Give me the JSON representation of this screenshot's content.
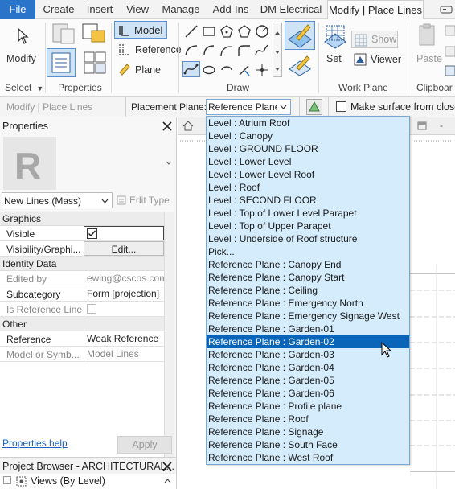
{
  "ribbon": {
    "tabs": [
      "File",
      "Create",
      "Insert",
      "View",
      "Manage",
      "Add-Ins",
      "DM Electrical",
      "Modify | Place Lines"
    ],
    "active_tab": "Modify | Place Lines",
    "buttons": {
      "modify": "Modify",
      "model": "Model",
      "reference": "Reference",
      "plane": "Plane",
      "show": "Show",
      "set": "Set",
      "viewer": "Viewer",
      "paste": "Paste"
    },
    "panels": {
      "select": "Select",
      "properties": "Properties",
      "draw": "Draw",
      "work_plane": "Work Plane",
      "clipboard": "Clipboar"
    }
  },
  "options_bar": {
    "context": "Modify | Place Lines",
    "placement_label": "Placement Plane:",
    "placement_value": "Reference Plane",
    "make_surface": "Make surface from close"
  },
  "properties": {
    "title": "Properties",
    "type_name": "New Lines (Mass)",
    "edit_type": "Edit Type",
    "sections": {
      "graphics": "Graphics",
      "identity": "Identity Data",
      "other": "Other"
    },
    "rows": {
      "visible": "Visible",
      "visibility": "Visibility/Graphi...",
      "visibility_btn": "Edit...",
      "edited_by": "Edited by",
      "edited_by_val": "ewing@cscos.com",
      "subcategory": "Subcategory",
      "subcategory_val": "Form [projection]",
      "is_ref": "Is Reference Line",
      "reference": "Reference",
      "reference_val": "Weak Reference",
      "model_or_symb": "Model or Symb...",
      "model_or_symb_val": "Model Lines"
    },
    "help_link": "Properties help",
    "apply": "Apply"
  },
  "project_browser": {
    "title": "Project Browser - ARCHITECTURAL...",
    "views": "Views (By Level)"
  },
  "dropdown": {
    "items": [
      "Level : Atrium Roof",
      "Level : Canopy",
      "Level : GROUND FLOOR",
      "Level : Lower Level",
      "Level : Lower Level Roof",
      "Level : Roof",
      "Level : SECOND FLOOR",
      "Level : Top of Lower Level Parapet",
      "Level : Top of Upper Parapet",
      "Level : Underside of Roof structure",
      "Pick...",
      "Reference Plane : Canopy End",
      "Reference Plane : Canopy Start",
      "Reference Plane : Ceiling",
      "Reference Plane : Emergency  North",
      "Reference Plane : Emergency Signage West",
      "Reference Plane : Garden-01",
      "Reference Plane : Garden-02",
      "Reference Plane : Garden-03",
      "Reference Plane : Garden-04",
      "Reference Plane : Garden-05",
      "Reference Plane : Garden-06",
      "Reference Plane : Profile plane",
      "Reference Plane : Roof",
      "Reference Plane : Signage",
      "Reference Plane : South Face",
      "Reference Plane : West Roof"
    ],
    "selected": "Reference Plane : Garden-02"
  },
  "colors": {
    "file_tab": "#2a74c9",
    "dropdown_bg": "#d4ecfb",
    "selection": "#0a64b7"
  }
}
